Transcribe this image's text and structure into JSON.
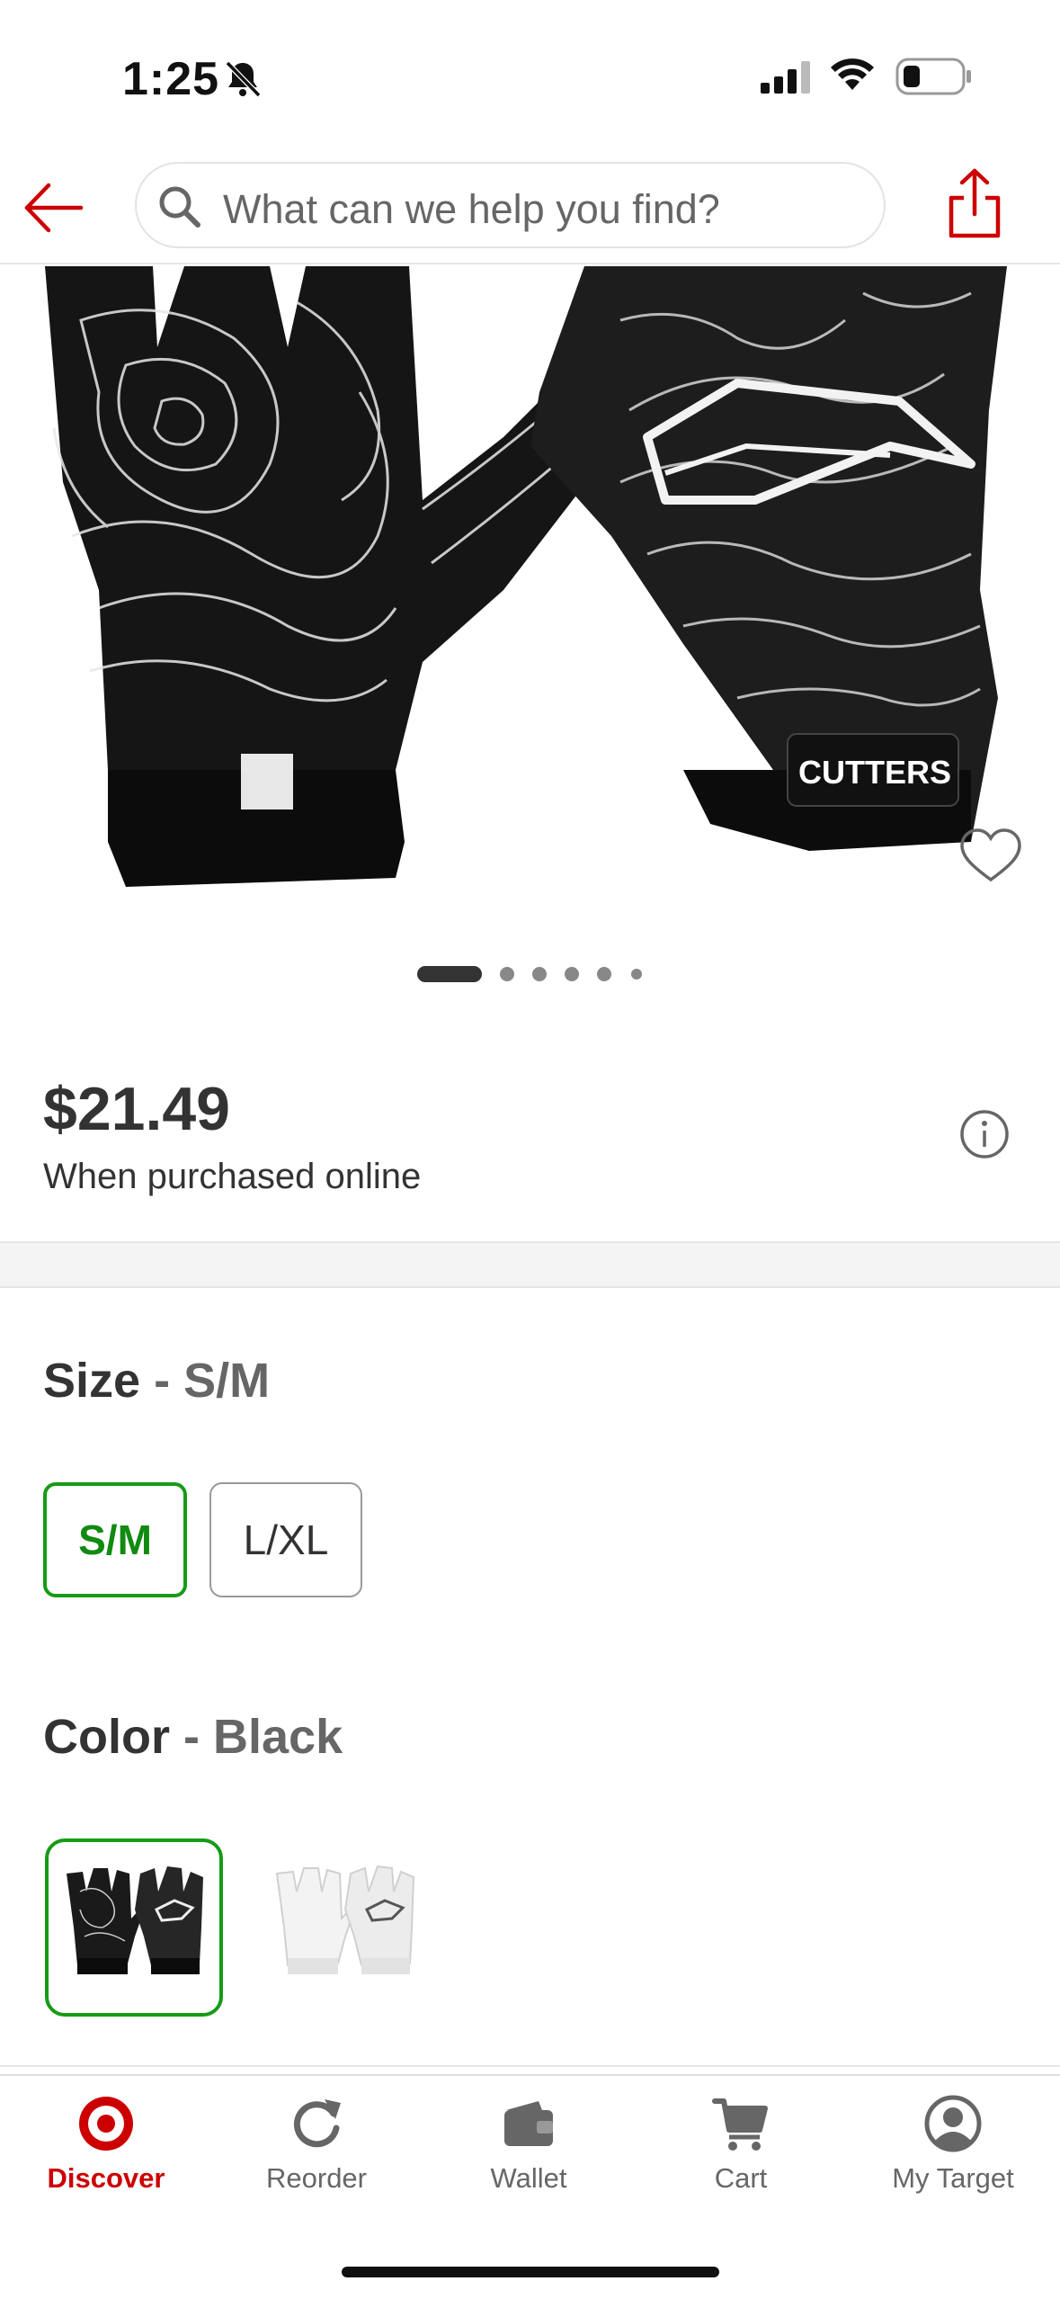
{
  "status_bar": {
    "time": "1:25"
  },
  "header": {
    "search_placeholder": "What can we help you find?"
  },
  "product": {
    "brand_mark": "CUTTERS",
    "price": "$21.49",
    "price_note": "When purchased online",
    "image_count": 6,
    "active_image_index": 0
  },
  "size": {
    "title": "Size",
    "separator": " - ",
    "selected": "S/M",
    "options": [
      "S/M",
      "L/XL"
    ]
  },
  "color": {
    "title": "Color",
    "separator": " - ",
    "selected": "Black",
    "options": [
      "Black",
      "White"
    ]
  },
  "tabs": [
    {
      "label": "Discover",
      "icon": "target-logo-icon",
      "active": true
    },
    {
      "label": "Reorder",
      "icon": "reorder-icon",
      "active": false
    },
    {
      "label": "Wallet",
      "icon": "wallet-icon",
      "active": false
    },
    {
      "label": "Cart",
      "icon": "cart-icon",
      "active": false
    },
    {
      "label": "My Target",
      "icon": "profile-icon",
      "active": false
    }
  ],
  "colors": {
    "brand_red": "#cc0000",
    "selected_green": "#169b16",
    "text_dark": "#333333",
    "text_gray": "#666666"
  }
}
